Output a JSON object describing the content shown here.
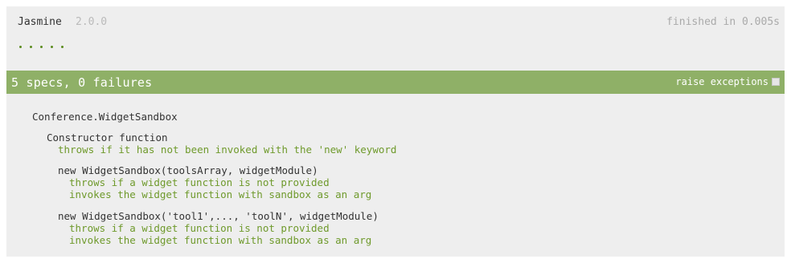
{
  "header": {
    "title": "Jasmine",
    "version": "2.0.0",
    "duration": "finished in 0.005s"
  },
  "symbols": {
    "passed_count": 5,
    "color": "#5b8c1f"
  },
  "bar": {
    "summary": "5 specs, 0 failures",
    "raise_label": "raise exceptions",
    "raise_checked": false,
    "color": "#8fb067"
  },
  "results": {
    "suite": "Conference.WidgetSandbox",
    "groups": [
      {
        "name": "Constructor function",
        "specs": [
          "throws if it has not been invoked with the 'new' keyword"
        ]
      },
      {
        "name": "new WidgetSandbox(toolsArray, widgetModule)",
        "specs": [
          "throws if a widget function is not provided",
          "invokes the widget function with sandbox as an arg"
        ]
      },
      {
        "name": "new WidgetSandbox('tool1',..., 'toolN', widgetModule)",
        "specs": [
          "throws if a widget function is not provided",
          "invokes the widget function with sandbox as an arg"
        ]
      }
    ]
  }
}
